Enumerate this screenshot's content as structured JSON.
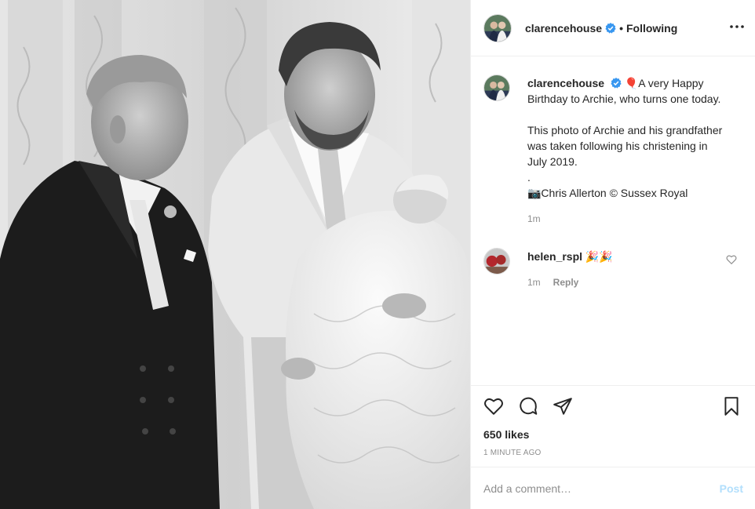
{
  "post": {
    "account": {
      "username": "clarencehouse",
      "verified": true,
      "follow_state": "Following",
      "separator": "•"
    },
    "caption": {
      "username": "clarencehouse",
      "emoji": "🎈",
      "text": "A very Happy Birthday to Archie, who turns one today.\n\nThis photo of Archie and his grandfather was taken following his christening in July 2019.\n.\n📷Chris Allerton © Sussex Royal",
      "time": "1m"
    },
    "comments": [
      {
        "username": "helen_rspl",
        "text": "🎉🎉",
        "time": "1m",
        "reply_label": "Reply"
      }
    ],
    "likes": "650 likes",
    "timestamp": "1 MINUTE AGO",
    "add_comment": {
      "placeholder": "Add a comment…",
      "post_label": "Post"
    },
    "icons": {
      "more": "more-options-icon",
      "verified": "verified-badge-icon",
      "like": "heart-icon",
      "comment": "comment-icon",
      "share": "paper-plane-icon",
      "save": "bookmark-icon",
      "comment_like": "heart-icon"
    },
    "colors": {
      "verified": "#3897f0",
      "link": "#b2dffc",
      "muted": "#8e8e8e"
    }
  }
}
